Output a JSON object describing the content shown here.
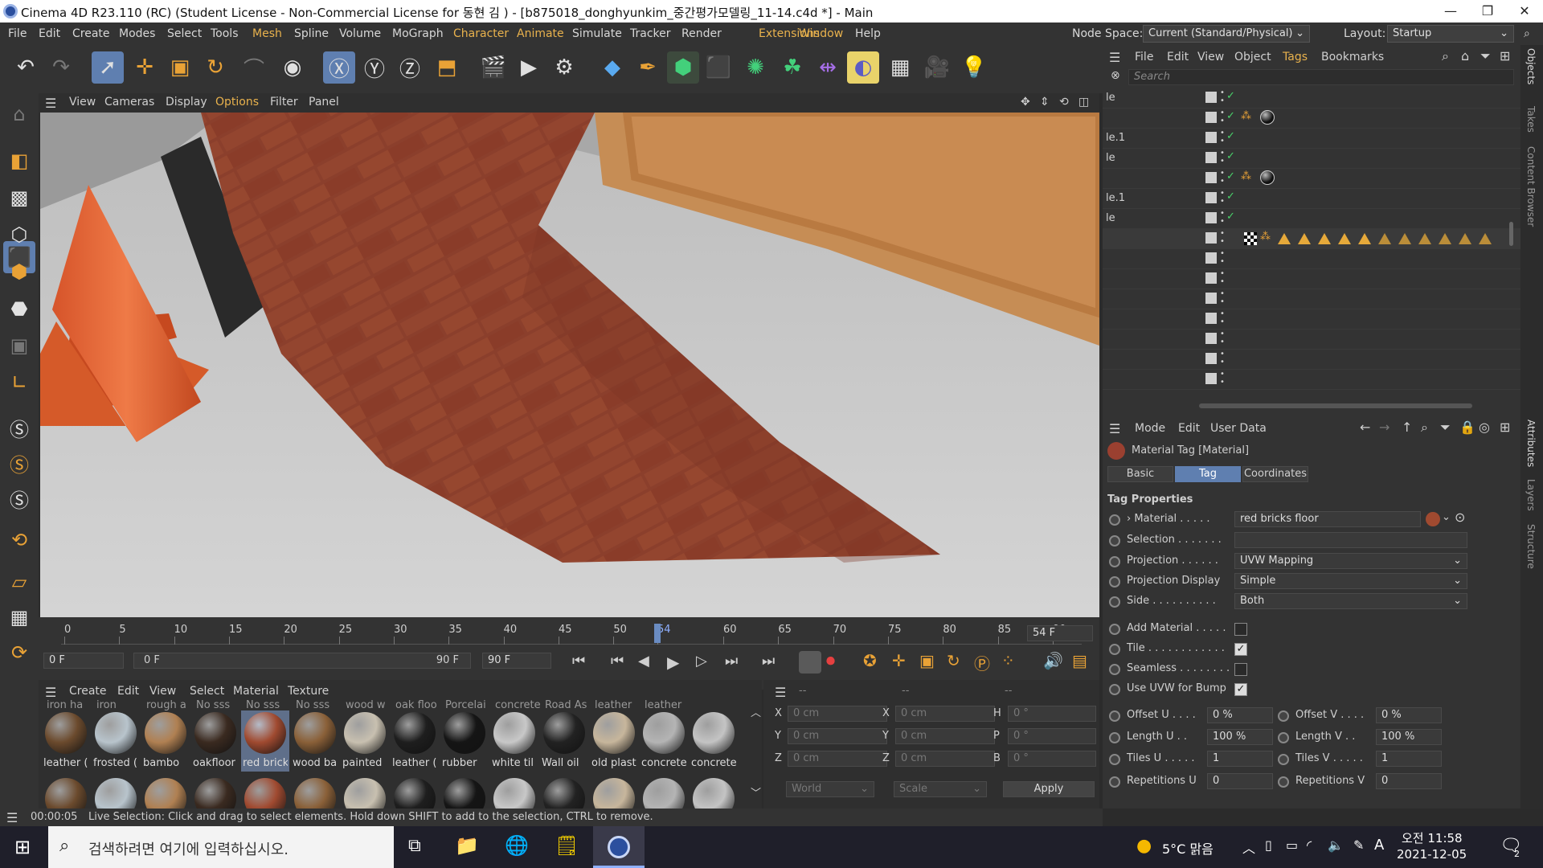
{
  "window": {
    "title": "Cinema 4D R23.110 (RC) (Student License - Non-Commercial License for 동현 김 ) - [b875018_donghyunkim_중간평가모델링_11-14.c4d *] - Main"
  },
  "menu": [
    "File",
    "Edit",
    "Create",
    "Modes",
    "Select",
    "Tools",
    "Mesh",
    "Spline",
    "Volume",
    "MoGraph",
    "Character",
    "Animate",
    "Simulate",
    "Tracker",
    "Render",
    "Extensions",
    "Window",
    "Help"
  ],
  "node_space": {
    "label": "Node Space:",
    "value": "Current (Standard/Physical)"
  },
  "layout": {
    "label": "Layout:",
    "value": "Startup"
  },
  "viewport_menu": [
    "View",
    "Cameras",
    "Display",
    "Options",
    "Filter",
    "Panel"
  ],
  "timeline": {
    "ticks": [
      "0",
      "5",
      "10",
      "15",
      "20",
      "25",
      "30",
      "35",
      "40",
      "45",
      "50",
      "54",
      "60",
      "65",
      "70",
      "75",
      "80",
      "85",
      "90"
    ],
    "current": "54 F",
    "start": "0 F",
    "range_start": "0 F",
    "range_end": "90 F",
    "end": "90 F",
    "current_frame": 54,
    "max_frame": 90
  },
  "material_menu": [
    "Create",
    "Edit",
    "View",
    "Select",
    "Material",
    "Texture"
  ],
  "materials": [
    {
      "name": "leather (",
      "color": "#6b4a2d"
    },
    {
      "name": "frosted (",
      "color": "#b8c4cc"
    },
    {
      "name": "bambo",
      "color": "#b08052"
    },
    {
      "name": "oakfloor",
      "color": "#3a2a20"
    },
    {
      "name": "red brick",
      "color": "#a04a30"
    },
    {
      "name": "wood ba",
      "color": "#8a6038"
    },
    {
      "name": "painted",
      "color": "#c8c0b0"
    },
    {
      "name": "leather (",
      "color": "#1e1e1e"
    },
    {
      "name": "rubber",
      "color": "#151515"
    },
    {
      "name": "white til",
      "color": "#c8c8c8"
    },
    {
      "name": "Wall oil",
      "color": "#222222"
    },
    {
      "name": "old plast",
      "color": "#c7b69c"
    },
    {
      "name": "concrete",
      "color": "#b4b4b4"
    },
    {
      "name": "concrete",
      "color": "#c4c4c4"
    }
  ],
  "material_top_labels": [
    "iron ha",
    "iron",
    "rough a",
    "No sss",
    "No sss",
    "No sss",
    "wood w",
    "oak floo",
    "Porcelai",
    "concrete",
    "Road As",
    "leather",
    "leather"
  ],
  "coords": {
    "header": [
      "--",
      "--",
      "--"
    ],
    "rows": [
      [
        "X",
        "0 cm",
        "X",
        "0 cm",
        "H",
        "0 °"
      ],
      [
        "Y",
        "0 cm",
        "Y",
        "0 cm",
        "P",
        "0 °"
      ],
      [
        "Z",
        "0 cm",
        "Z",
        "0 cm",
        "B",
        "0 °"
      ]
    ],
    "world": "World",
    "scale": "Scale",
    "apply": "Apply"
  },
  "status": {
    "time": "00:00:05",
    "message": "Live Selection: Click and drag to select elements. Hold down SHIFT to add to the selection, CTRL to remove."
  },
  "objects": {
    "menu": [
      "File",
      "Edit",
      "View",
      "Object",
      "Tags",
      "Bookmarks"
    ],
    "search_placeholder": "Search",
    "rows": [
      "le",
      "",
      "le.1",
      "le",
      "",
      "le.1",
      "le",
      "",
      "",
      "",
      "",
      "",
      "",
      "",
      ""
    ]
  },
  "attributes": {
    "menu": [
      "Mode",
      "Edit",
      "User Data"
    ],
    "title": "Material Tag [Material]",
    "tabs": [
      "Basic",
      "Tag",
      "Coordinates"
    ],
    "section": "Tag Properties",
    "material_label": "Material",
    "material_value": "red bricks floor",
    "selection_label": "Selection",
    "projection_label": "Projection",
    "projection_value": "UVW Mapping",
    "projdisp_label": "Projection Display",
    "projdisp_value": "Simple",
    "side_label": "Side",
    "side_value": "Both",
    "add_material": "Add Material",
    "tile": "Tile",
    "seamless": "Seamless",
    "use_uvw": "Use UVW for Bump",
    "offset_u": "Offset U",
    "offset_u_val": "0 %",
    "offset_v": "Offset V",
    "offset_v_val": "0 %",
    "length_u": "Length U",
    "length_u_val": "100 %",
    "length_v": "Length V",
    "length_v_val": "100 %",
    "tiles_u": "Tiles U",
    "tiles_u_val": "1",
    "tiles_v": "Tiles V",
    "tiles_v_val": "1",
    "rep_u": "Repetitions U",
    "rep_u_val": "0",
    "rep_v": "Repetitions V",
    "rep_v_val": "0"
  },
  "right_tabs": [
    "Objects",
    "Takes",
    "Content Browser",
    "Attributes",
    "Layers",
    "Structure"
  ],
  "taskbar": {
    "search": "검색하려면 여기에 입력하십시오.",
    "weather": "5°C 맑음",
    "time": "오전 11:58",
    "date": "2021-12-05",
    "ime": "A",
    "notif": "2"
  },
  "colors": {
    "accent": "#5f7fb0",
    "highlight": "#e9b24d",
    "brick": "#8a3b2a"
  }
}
